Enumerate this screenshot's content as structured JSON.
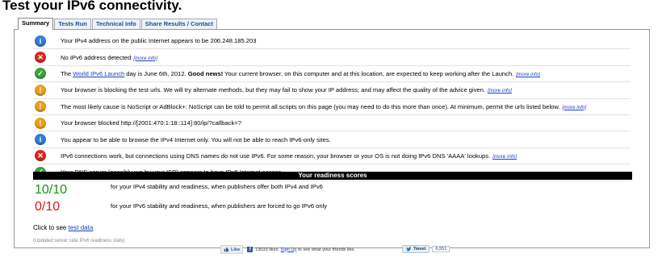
{
  "page": {
    "title": "Test your IPv6 connectivity."
  },
  "tabs": [
    {
      "label": "Summary",
      "active": true
    },
    {
      "label": "Tests Run",
      "active": false
    },
    {
      "label": "Technical Info",
      "active": false
    },
    {
      "label": "Share Results / Contact",
      "active": false
    }
  ],
  "results": [
    {
      "status": "info-icon",
      "text": "Your IPv4 address on the public Internet appears to be 206.248.185.203"
    },
    {
      "status": "error-icon",
      "text": "No IPv6 address detected",
      "more": "[more info]"
    },
    {
      "status": "ok-icon",
      "pre": "The ",
      "link": "World IPv6 Launch",
      "mid": " day is June 6th, 2012. ",
      "bold": "Good news!",
      "post": " Your current browser, on this computer and at this location, are expected to keep working after the Launch.",
      "more": "[more info]"
    },
    {
      "status": "warning-icon",
      "text": "Your browser is blocking the test urls. We will try alternate methods, but they may fail to show your IP address; and may affect the quality of the advice given.",
      "more": "[more info]"
    },
    {
      "status": "warning-icon",
      "text": "The most likely cause is NoScript or AdBlock+: NoScript can be told to permit all scripts on this page (you may need to do this more than once). At minimum, permit the urls listed below.",
      "more": "[more info]"
    },
    {
      "status": "warning-icon",
      "text": "Your browser blocked http://[2001:470:1:18::114]:80/ip/?callback=?"
    },
    {
      "status": "info-icon",
      "text": "You appear to be able to browse the IPv4 Internet only. You will not be able to reach IPv6-only sites."
    },
    {
      "status": "error-icon",
      "text": "IPv6 connections work, but connections using DNS names do not use IPv6. For some reason, your browser or your OS is not doing IPv6 DNS 'AAAA' lookups.",
      "more": "[more info]"
    },
    {
      "status": "ok-icon",
      "text": "Your DNS server (possibly run by your ISP) appears to have IPv6 Internet access."
    }
  ],
  "scores": {
    "header": "Your readiness scores",
    "ipv4": {
      "value": "10/10",
      "desc": "for your IPv4 stability and readiness, when publishers offer both IPv4 and IPv6",
      "color": "#199119"
    },
    "ipv6": {
      "value": "0/10",
      "desc": "for your IPv6 stability and readiness, when publishers are forced to go IPv6 only",
      "color": "#d11a1a"
    }
  },
  "click_line": {
    "prefix": "Click to see ",
    "link": "test data"
  },
  "footnote": "(Updated server side IPv6 readiness stats)",
  "social": {
    "fb_like": "Like",
    "fb_text_count": "13033 likes.",
    "fb_signup": "Sign Up",
    "fb_text_rest": "to see what your friends like.",
    "tweet": "Tweet",
    "tweet_count": "6,551"
  }
}
